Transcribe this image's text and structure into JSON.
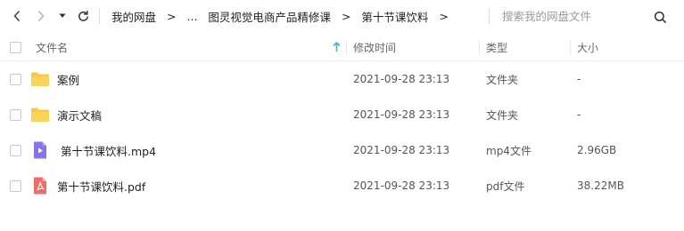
{
  "nav": {
    "back_icon": "chevron-left-icon",
    "forward_icon": "chevron-right-icon",
    "dropdown_icon": "caret-down-icon",
    "refresh_icon": "refresh-icon"
  },
  "breadcrumb": {
    "items": [
      "我的网盘",
      "...",
      "图灵视觉电商产品精修课",
      "第十节课饮料"
    ],
    "separator": ">"
  },
  "search": {
    "value": "",
    "placeholder": "搜索我的网盘文件",
    "icon": "search-icon"
  },
  "columns": {
    "name": "文件名",
    "modified": "修改时间",
    "type": "类型",
    "size": "大小",
    "sort_icon": "sort-ascending-icon"
  },
  "files": [
    {
      "name": "案例",
      "modified": "2021-09-28 23:13",
      "type": "文件夹",
      "size": "-",
      "icon": "folder-icon"
    },
    {
      "name": "演示文稿",
      "modified": "2021-09-28 23:13",
      "type": "文件夹",
      "size": "-",
      "icon": "folder-icon"
    },
    {
      "name": "第十节课饮料.mp4",
      "modified": "2021-09-28 23:13",
      "type": "mp4文件",
      "size": "2.96GB",
      "icon": "video-file-icon"
    },
    {
      "name": "第十节课饮料.pdf",
      "modified": "2021-09-28 23:13",
      "type": "pdf文件",
      "size": "38.22MB",
      "icon": "pdf-file-icon"
    }
  ],
  "colors": {
    "folder": "#f7c843",
    "video": "#8a73e6",
    "pdf": "#f06a6a",
    "sort_accent": "#3db6c6"
  }
}
